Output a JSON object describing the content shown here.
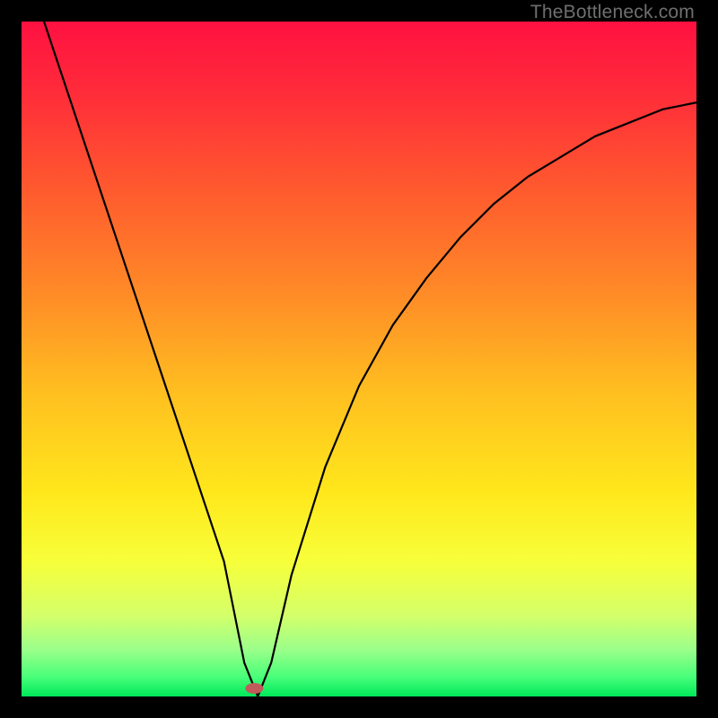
{
  "watermark": "TheBottleneck.com",
  "chart_data": {
    "type": "line",
    "title": "",
    "xlabel": "",
    "ylabel": "",
    "xlim": [
      0,
      100
    ],
    "ylim": [
      0,
      100
    ],
    "grid": false,
    "series": [
      {
        "name": "curve",
        "x": [
          0,
          5,
          10,
          15,
          20,
          25,
          30,
          33,
          35,
          37,
          40,
          45,
          50,
          55,
          60,
          65,
          70,
          75,
          80,
          85,
          90,
          95,
          100
        ],
        "values": [
          110,
          95,
          80,
          65,
          50,
          35,
          20,
          5,
          0,
          5,
          18,
          34,
          46,
          55,
          62,
          68,
          73,
          77,
          80,
          83,
          85,
          87,
          88
        ]
      }
    ],
    "marker": {
      "x": 34.5,
      "y": 1.2
    },
    "gradient_stops": [
      {
        "offset": 0.0,
        "color": "#ff1141"
      },
      {
        "offset": 0.1,
        "color": "#ff2a3a"
      },
      {
        "offset": 0.25,
        "color": "#ff5a2e"
      },
      {
        "offset": 0.4,
        "color": "#ff8a27"
      },
      {
        "offset": 0.55,
        "color": "#ffbf20"
      },
      {
        "offset": 0.7,
        "color": "#ffe81c"
      },
      {
        "offset": 0.8,
        "color": "#f7ff3a"
      },
      {
        "offset": 0.88,
        "color": "#d4ff6a"
      },
      {
        "offset": 0.93,
        "color": "#9bff8a"
      },
      {
        "offset": 0.97,
        "color": "#4bff7a"
      },
      {
        "offset": 1.0,
        "color": "#00e85a"
      }
    ]
  }
}
